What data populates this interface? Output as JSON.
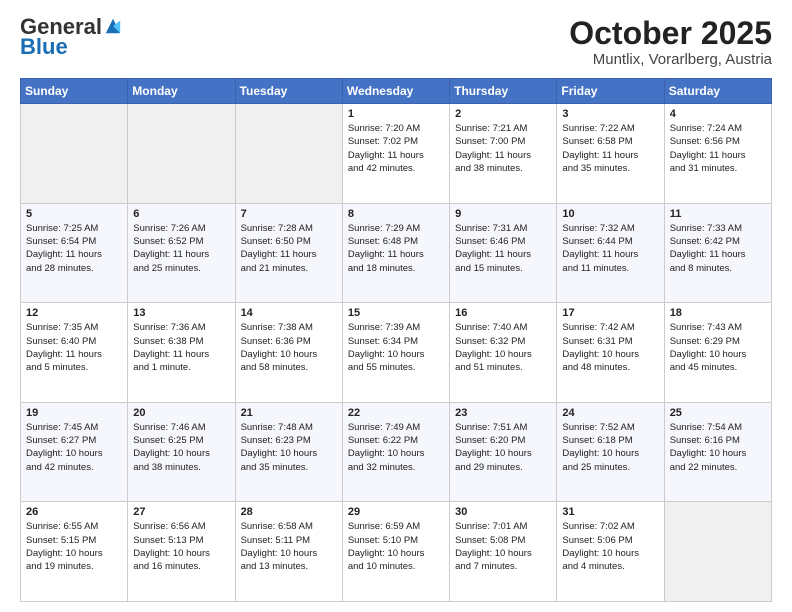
{
  "logo": {
    "general": "General",
    "blue": "Blue"
  },
  "header": {
    "month": "October 2025",
    "location": "Muntlix, Vorarlberg, Austria"
  },
  "days_of_week": [
    "Sunday",
    "Monday",
    "Tuesday",
    "Wednesday",
    "Thursday",
    "Friday",
    "Saturday"
  ],
  "weeks": [
    [
      {
        "day": "",
        "info": ""
      },
      {
        "day": "",
        "info": ""
      },
      {
        "day": "",
        "info": ""
      },
      {
        "day": "1",
        "info": "Sunrise: 7:20 AM\nSunset: 7:02 PM\nDaylight: 11 hours\nand 42 minutes."
      },
      {
        "day": "2",
        "info": "Sunrise: 7:21 AM\nSunset: 7:00 PM\nDaylight: 11 hours\nand 38 minutes."
      },
      {
        "day": "3",
        "info": "Sunrise: 7:22 AM\nSunset: 6:58 PM\nDaylight: 11 hours\nand 35 minutes."
      },
      {
        "day": "4",
        "info": "Sunrise: 7:24 AM\nSunset: 6:56 PM\nDaylight: 11 hours\nand 31 minutes."
      }
    ],
    [
      {
        "day": "5",
        "info": "Sunrise: 7:25 AM\nSunset: 6:54 PM\nDaylight: 11 hours\nand 28 minutes."
      },
      {
        "day": "6",
        "info": "Sunrise: 7:26 AM\nSunset: 6:52 PM\nDaylight: 11 hours\nand 25 minutes."
      },
      {
        "day": "7",
        "info": "Sunrise: 7:28 AM\nSunset: 6:50 PM\nDaylight: 11 hours\nand 21 minutes."
      },
      {
        "day": "8",
        "info": "Sunrise: 7:29 AM\nSunset: 6:48 PM\nDaylight: 11 hours\nand 18 minutes."
      },
      {
        "day": "9",
        "info": "Sunrise: 7:31 AM\nSunset: 6:46 PM\nDaylight: 11 hours\nand 15 minutes."
      },
      {
        "day": "10",
        "info": "Sunrise: 7:32 AM\nSunset: 6:44 PM\nDaylight: 11 hours\nand 11 minutes."
      },
      {
        "day": "11",
        "info": "Sunrise: 7:33 AM\nSunset: 6:42 PM\nDaylight: 11 hours\nand 8 minutes."
      }
    ],
    [
      {
        "day": "12",
        "info": "Sunrise: 7:35 AM\nSunset: 6:40 PM\nDaylight: 11 hours\nand 5 minutes."
      },
      {
        "day": "13",
        "info": "Sunrise: 7:36 AM\nSunset: 6:38 PM\nDaylight: 11 hours\nand 1 minute."
      },
      {
        "day": "14",
        "info": "Sunrise: 7:38 AM\nSunset: 6:36 PM\nDaylight: 10 hours\nand 58 minutes."
      },
      {
        "day": "15",
        "info": "Sunrise: 7:39 AM\nSunset: 6:34 PM\nDaylight: 10 hours\nand 55 minutes."
      },
      {
        "day": "16",
        "info": "Sunrise: 7:40 AM\nSunset: 6:32 PM\nDaylight: 10 hours\nand 51 minutes."
      },
      {
        "day": "17",
        "info": "Sunrise: 7:42 AM\nSunset: 6:31 PM\nDaylight: 10 hours\nand 48 minutes."
      },
      {
        "day": "18",
        "info": "Sunrise: 7:43 AM\nSunset: 6:29 PM\nDaylight: 10 hours\nand 45 minutes."
      }
    ],
    [
      {
        "day": "19",
        "info": "Sunrise: 7:45 AM\nSunset: 6:27 PM\nDaylight: 10 hours\nand 42 minutes."
      },
      {
        "day": "20",
        "info": "Sunrise: 7:46 AM\nSunset: 6:25 PM\nDaylight: 10 hours\nand 38 minutes."
      },
      {
        "day": "21",
        "info": "Sunrise: 7:48 AM\nSunset: 6:23 PM\nDaylight: 10 hours\nand 35 minutes."
      },
      {
        "day": "22",
        "info": "Sunrise: 7:49 AM\nSunset: 6:22 PM\nDaylight: 10 hours\nand 32 minutes."
      },
      {
        "day": "23",
        "info": "Sunrise: 7:51 AM\nSunset: 6:20 PM\nDaylight: 10 hours\nand 29 minutes."
      },
      {
        "day": "24",
        "info": "Sunrise: 7:52 AM\nSunset: 6:18 PM\nDaylight: 10 hours\nand 25 minutes."
      },
      {
        "day": "25",
        "info": "Sunrise: 7:54 AM\nSunset: 6:16 PM\nDaylight: 10 hours\nand 22 minutes."
      }
    ],
    [
      {
        "day": "26",
        "info": "Sunrise: 6:55 AM\nSunset: 5:15 PM\nDaylight: 10 hours\nand 19 minutes."
      },
      {
        "day": "27",
        "info": "Sunrise: 6:56 AM\nSunset: 5:13 PM\nDaylight: 10 hours\nand 16 minutes."
      },
      {
        "day": "28",
        "info": "Sunrise: 6:58 AM\nSunset: 5:11 PM\nDaylight: 10 hours\nand 13 minutes."
      },
      {
        "day": "29",
        "info": "Sunrise: 6:59 AM\nSunset: 5:10 PM\nDaylight: 10 hours\nand 10 minutes."
      },
      {
        "day": "30",
        "info": "Sunrise: 7:01 AM\nSunset: 5:08 PM\nDaylight: 10 hours\nand 7 minutes."
      },
      {
        "day": "31",
        "info": "Sunrise: 7:02 AM\nSunset: 5:06 PM\nDaylight: 10 hours\nand 4 minutes."
      },
      {
        "day": "",
        "info": ""
      }
    ]
  ]
}
